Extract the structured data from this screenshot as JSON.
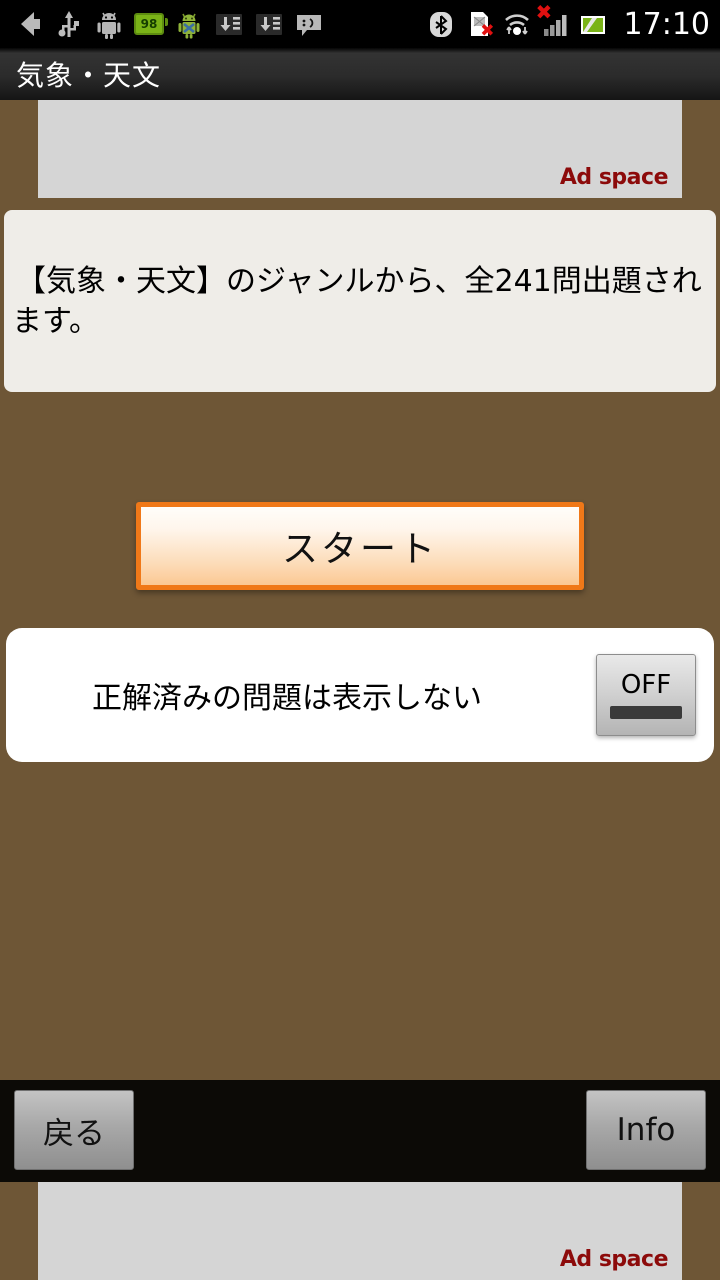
{
  "statusbar": {
    "clock": "17:10",
    "left_icons": [
      {
        "name": "back-arrow-icon",
        "glyph": "⮜"
      },
      {
        "name": "usb-icon",
        "glyph": "⑂"
      },
      {
        "name": "android-robot-icon",
        "glyph": "🤖"
      },
      {
        "name": "battery-icon",
        "level": "98"
      },
      {
        "name": "android-sync-icon",
        "glyph": "🤖"
      },
      {
        "name": "download-list-icon",
        "glyph": "⬇"
      },
      {
        "name": "download-list-icon-2",
        "glyph": "⬇"
      },
      {
        "name": "sms-smiley-icon",
        "glyph": ":)"
      }
    ],
    "right_icons": [
      {
        "name": "bluetooth-icon",
        "glyph": "ᛦ"
      },
      {
        "name": "sim-card-error-icon",
        "glyph": "▣"
      },
      {
        "name": "wifi-transfer-icon",
        "glyph": "●"
      },
      {
        "name": "signal-bars-icon",
        "error": "×"
      },
      {
        "name": "battery-charging-icon",
        "glyph": "⚡"
      }
    ]
  },
  "titlebar": {
    "title": "気象・天文"
  },
  "ads": {
    "top_label": "Ad space",
    "bottom_label": "Ad space"
  },
  "info_panel": {
    "text": "【気象・天文】のジャンルから、全241問出題されます。",
    "genre": "気象・天文",
    "question_count": "241"
  },
  "start_button": {
    "label": "スタート"
  },
  "toggle_row": {
    "label": "正解済みの問題は表示しない",
    "state": "OFF"
  },
  "bottombar": {
    "back_label": "戻る",
    "info_label": "Info"
  },
  "colors": {
    "background_brown": "#6e5636",
    "panel_cream": "#efede8",
    "start_orange": "#f07818",
    "ad_red": "#8c0a0a",
    "bottom_black": "#0c0a06"
  }
}
